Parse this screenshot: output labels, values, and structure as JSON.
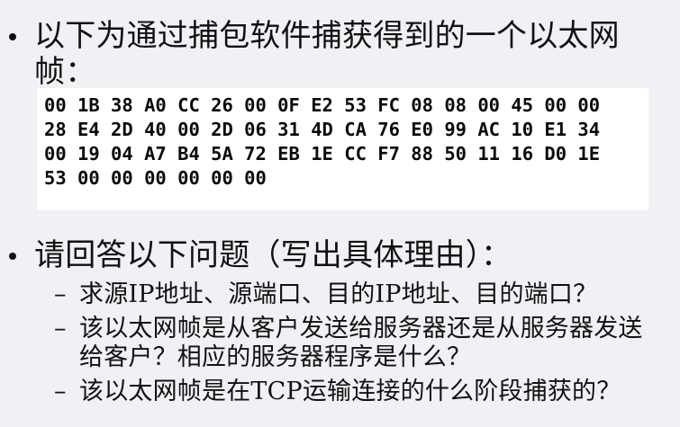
{
  "bullet1": {
    "text": "以下为通过捕包软件捕获得到的一个以太网帧："
  },
  "hex_frame": {
    "lines": [
      "00 1B 38 A0 CC 26 00 0F E2 53 FC 08 08 00 45 00 00",
      "28 E4 2D 40 00 2D 06 31 4D CA 76 E0 99 AC 10 E1 34",
      "00 19 04 A7 B4 5A 72 EB 1E CC F7 88 50 11 16 D0 1E",
      "53 00 00 00 00 00 00"
    ]
  },
  "bullet2": {
    "text": "请回答以下问题（写出具体理由）："
  },
  "questions": [
    {
      "dash": "–",
      "text": "求源IP地址、源端口、目的IP地址、目的端口？"
    },
    {
      "dash": "–",
      "text": "该以太网帧是从客户发送给服务器还是从服务器发送给客户？相应的服务器程序是什么？"
    },
    {
      "dash": "–",
      "text": "该以太网帧是在TCP运输连接的什么阶段捕获的？"
    }
  ]
}
